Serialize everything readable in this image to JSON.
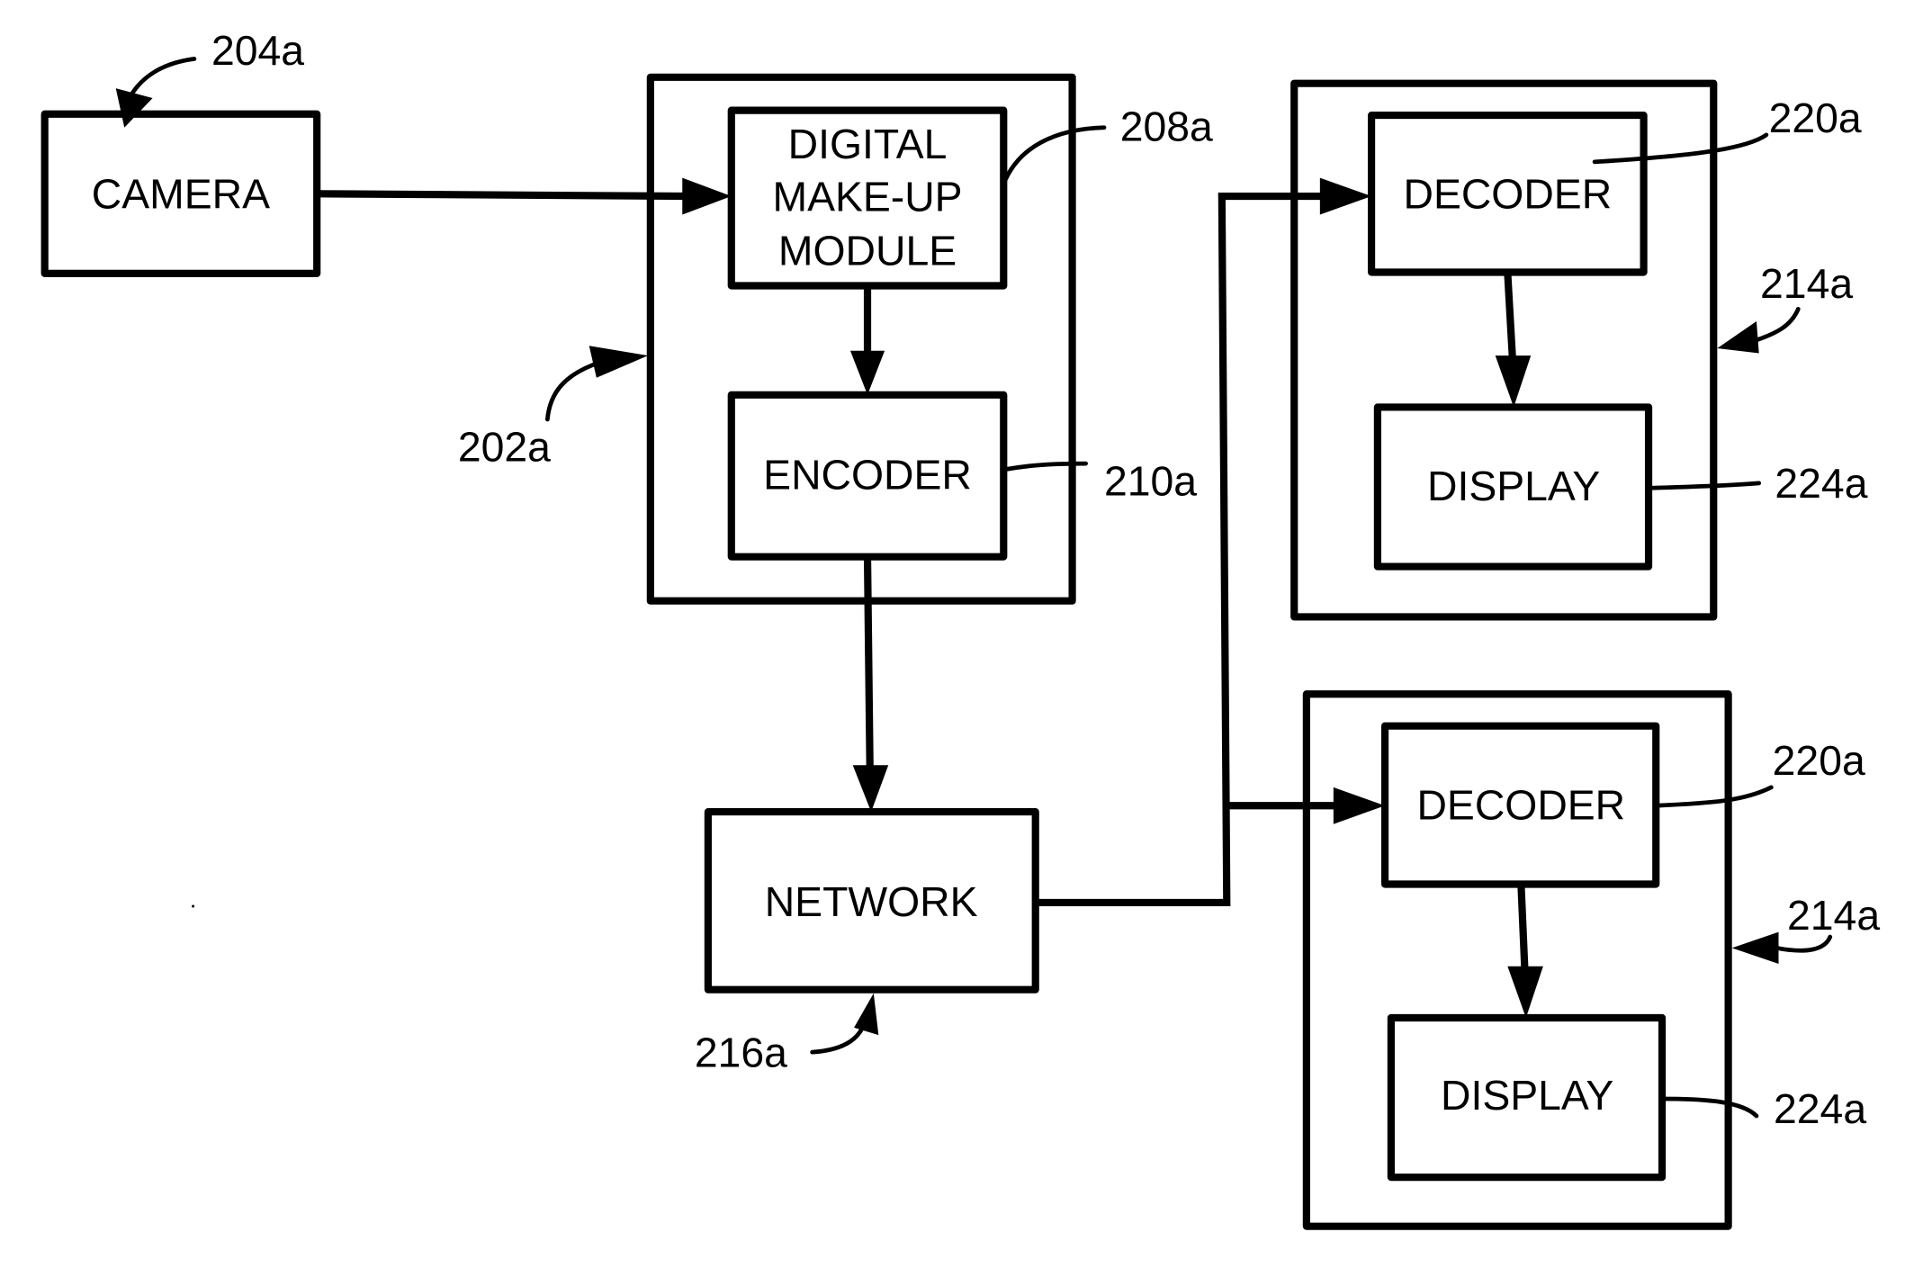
{
  "figure": {
    "blocks": {
      "camera": "CAMERA",
      "makeup_lines": [
        "DIGITAL",
        "MAKE-UP",
        "MODULE"
      ],
      "encoder": "ENCODER",
      "network": "NETWORK",
      "decoder_1": "DECODER",
      "display_1": "DISPLAY",
      "decoder_2": "DECODER",
      "display_2": "DISPLAY"
    },
    "refs": {
      "camera": "204a",
      "sender_device": "202a",
      "makeup_module": "208a",
      "encoder": "210a",
      "network": "216a",
      "decoder_1": "220a",
      "receiver_1": "214a",
      "display_1": "224a",
      "decoder_2": "220a",
      "receiver_2": "214a",
      "display_2": "224a"
    }
  }
}
